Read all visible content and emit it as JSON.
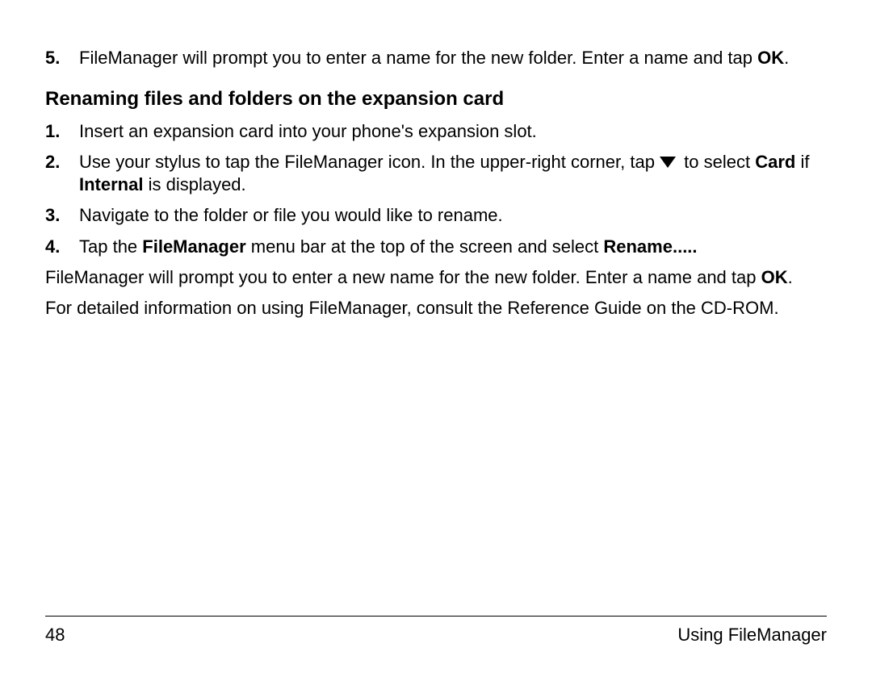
{
  "step5": {
    "num": "5.",
    "t1": "FileManager will prompt you to enter a name for the new folder. Enter a name and tap ",
    "ok": "OK",
    "t2": "."
  },
  "heading": "Renaming files and folders on the expansion card",
  "r1": {
    "num": "1.",
    "text": "Insert an expansion card into your phone's expansion slot."
  },
  "r2": {
    "num": "2.",
    "t1": "Use your stylus to tap the FileManager icon. In the upper-right corner, tap ",
    "t2": " to select ",
    "card": "Card",
    "t3": " if ",
    "internal": "Internal",
    "t4": " is displayed."
  },
  "r3": {
    "num": "3.",
    "text": "Navigate to the folder or file you would like to rename."
  },
  "r4": {
    "num": "4.",
    "t1": "Tap the ",
    "fm": "FileManager",
    "t2": " menu bar at the top of the screen and select ",
    "rename": "Rename.....",
    "t3": ""
  },
  "para1": {
    "t1": "FileManager will prompt you to enter a new name for the new folder. Enter a name and tap ",
    "ok": "OK",
    "t2": "."
  },
  "para2": "For detailed information on using FileManager, consult the Reference Guide on the CD-ROM.",
  "footer": {
    "page": "48",
    "section": "Using FileManager"
  }
}
